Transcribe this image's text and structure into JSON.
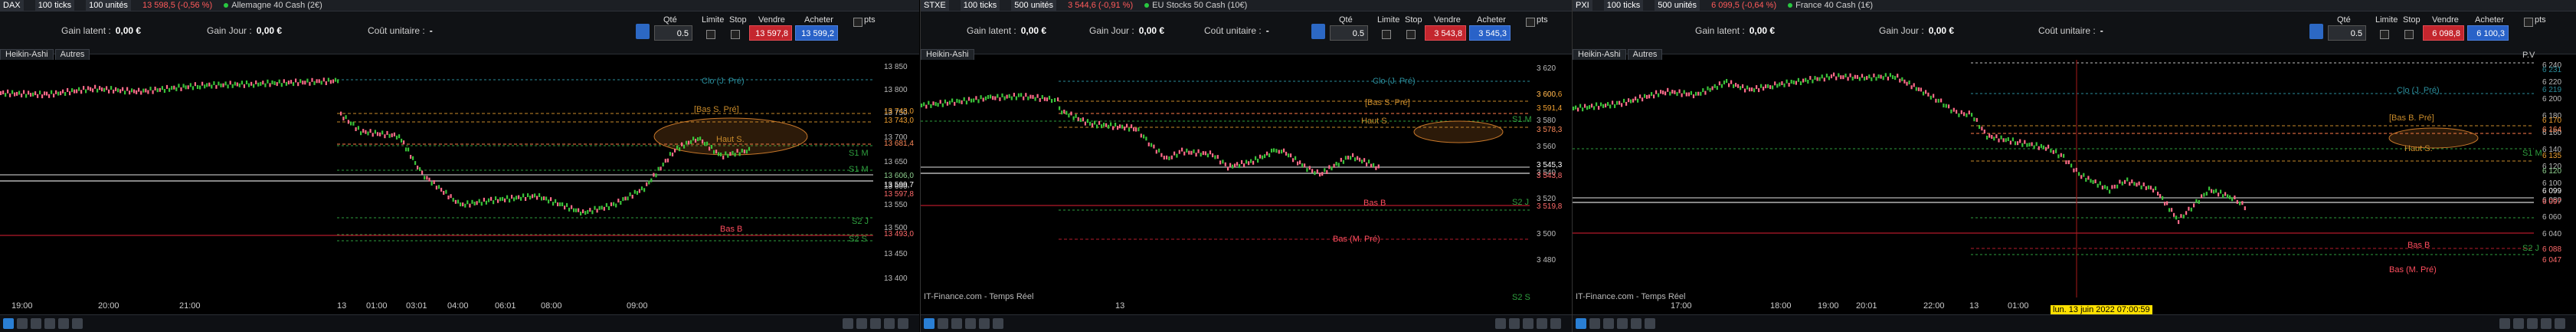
{
  "panels": [
    {
      "id": "dax",
      "top": {
        "instrument": "DAX",
        "ticks": "100 ticks",
        "units": "100 unités",
        "quote": "13 598,5 (-0,56 %)",
        "name": "Allemagne 40 Cash (2€)"
      },
      "info": {
        "gain_latent_label": "Gain latent :",
        "gain_latent": "0,00 €",
        "gain_jour_label": "Gain Jour :",
        "gain_jour": "0,00 €",
        "cout_label": "Coût unitaire :",
        "cout": "-"
      },
      "order": {
        "qte_label": "Qté",
        "qte": "0.5",
        "limite_label": "Limite",
        "stop_label": "Stop",
        "vendre_label": "Vendre",
        "acheter_label": "Acheter",
        "sell_price": "13 597,8",
        "buy_price": "13 599,2",
        "pts_label": "pts"
      },
      "tabs": [
        "Heikin-Ashi",
        "Autres"
      ],
      "y_ticks": [
        "13 850",
        "13 800",
        "13 750",
        "13 700",
        "13 650",
        "13 600",
        "13 550",
        "13 500",
        "13 450",
        "13 400"
      ],
      "price_tags": [
        "13 743,0",
        "13 743,0",
        "13 681,4",
        "13 606,0",
        "13 599,7",
        "13 597,8",
        "13 493,0"
      ],
      "x_ticks": [
        "19:00",
        "20:00",
        "21:00",
        "13",
        "01:00",
        "03:01",
        "04:00",
        "06:01",
        "08:00",
        "09:00"
      ],
      "levels": [
        "Clo (J. Pré)",
        "[Bas S. Pré]",
        "Haut S.",
        "S1 M",
        "S1 M",
        "S2 J",
        "Bas B",
        "S2 S"
      ]
    },
    {
      "id": "stoxx",
      "top": {
        "instrument": "STXE",
        "ticks": "100 ticks",
        "units": "500 unités",
        "quote": "3 544,6 (-0,91 %)",
        "name": "EU Stocks 50 Cash (10€)"
      },
      "info": {
        "gain_latent_label": "Gain latent :",
        "gain_latent": "0,00 €",
        "gain_jour_label": "Gain Jour :",
        "gain_jour": "0,00 €",
        "cout_label": "Coût unitaire :",
        "cout": "-"
      },
      "order": {
        "qte_label": "Qté",
        "qte": "0.5",
        "limite_label": "Limite",
        "stop_label": "Stop",
        "vendre_label": "Vendre",
        "acheter_label": "Acheter",
        "sell_price": "3 543,8",
        "buy_price": "3 545,3",
        "pts_label": "pts"
      },
      "tabs": [
        "Heikin-Ashi"
      ],
      "y_ticks": [
        "3 620",
        "3 600",
        "3 580",
        "3 560",
        "3 540",
        "3 520",
        "3 500",
        "3 480"
      ],
      "price_tags": [
        "3 600,6",
        "3 591,4",
        "3 578,3",
        "3 545,3",
        "3 543,8",
        "3 519,8"
      ],
      "x_ticks": [
        "13"
      ],
      "credit": "IT-Finance.com - Temps Réel",
      "levels": [
        "Clo (J. Pré)",
        "[Bas S. Pré]",
        "Haut S.",
        "Bas B",
        "Bas (M. Pré)",
        "S1 M",
        "S2 J",
        "S2 S"
      ]
    },
    {
      "id": "cac",
      "top": {
        "instrument": "PXI",
        "ticks": "100 ticks",
        "units": "500 unités",
        "quote": "6 099,5 (-0,64 %)",
        "name": "France 40 Cash (1€)"
      },
      "info": {
        "gain_latent_label": "Gain latent :",
        "gain_latent": "0,00 €",
        "gain_jour_label": "Gain Jour :",
        "gain_jour": "0,00 €",
        "cout_label": "Coût unitaire :",
        "cout": "-"
      },
      "order": {
        "qte_label": "Qté",
        "qte": "0.5",
        "limite_label": "Limite",
        "stop_label": "Stop",
        "vendre_label": "Vendre",
        "acheter_label": "Acheter",
        "sell_price": "6 098,8",
        "buy_price": "6 100,3",
        "pts_label": "pts"
      },
      "tabs": [
        "Heikin-Ashi",
        "Autres"
      ],
      "y_ticks": [
        "6 240",
        "6 220",
        "6 200",
        "6 180",
        "6 160",
        "6 140",
        "6 120",
        "6 100",
        "6 080",
        "6 060",
        "6 040"
      ],
      "price_tags": [
        "6 231",
        "6 219",
        "6 170",
        "6 164",
        "6 135",
        "6 120",
        "6 099",
        "6 097",
        "6 088",
        "6 047"
      ],
      "x_ticks": [
        "17:00",
        "18:00",
        "19:00",
        "20:01",
        "22:00",
        "13",
        "01:00"
      ],
      "credit": "IT-Finance.com - Temps Réel",
      "tooltip": "lun. 13 juin 2022 07:00:59",
      "levels": [
        "Clo (J. Pré)",
        "[Bas B. Pré]",
        "Haut S.",
        "Bas B",
        "Bas (M. Pré)",
        "P.V",
        "S1 M",
        "S2 J"
      ]
    }
  ],
  "colors": {
    "bull": "#39c339",
    "bear": "#ff6b8a",
    "level_green": "#2e9e3e",
    "level_red": "#b31b2b",
    "level_orange": "#c88a2a",
    "level_cyan": "#2a8c9a",
    "sell": "#c4262e",
    "buy": "#2962c8"
  }
}
